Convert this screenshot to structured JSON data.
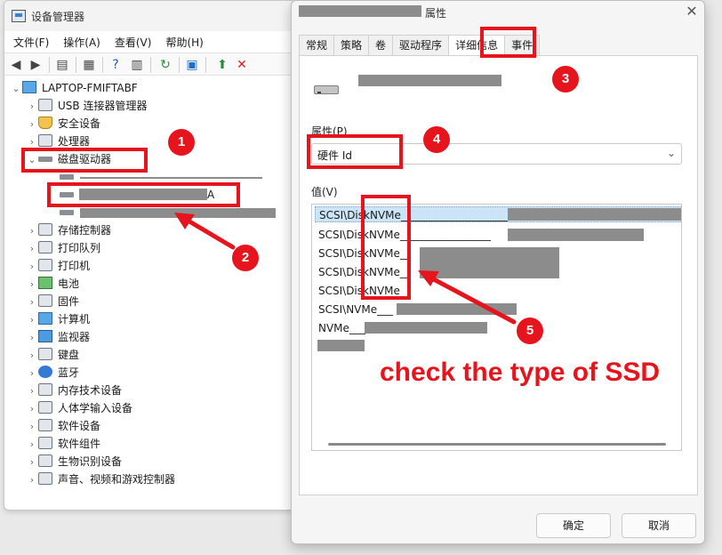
{
  "device_manager": {
    "title": "设备管理器",
    "menu": [
      "文件(F)",
      "操作(A)",
      "查看(V)",
      "帮助(H)"
    ],
    "root": "LAPTOP-FMIFTABF",
    "tree": [
      {
        "label": "USB 连接器管理器",
        "expanded": false
      },
      {
        "label": "安全设备",
        "expanded": false
      },
      {
        "label": "处理器",
        "expanded": false
      },
      {
        "label": "磁盘驱动器",
        "expanded": true
      },
      {
        "label": "存储控制器",
        "expanded": false
      },
      {
        "label": "打印队列",
        "expanded": false
      },
      {
        "label": "打印机",
        "expanded": false
      },
      {
        "label": "电池",
        "expanded": false
      },
      {
        "label": "固件",
        "expanded": false
      },
      {
        "label": "计算机",
        "expanded": false
      },
      {
        "label": "监视器",
        "expanded": false
      },
      {
        "label": "键盘",
        "expanded": false
      },
      {
        "label": "蓝牙",
        "expanded": false
      },
      {
        "label": "内存技术设备",
        "expanded": false
      },
      {
        "label": "人体学输入设备",
        "expanded": false
      },
      {
        "label": "软件设备",
        "expanded": false
      },
      {
        "label": "软件组件",
        "expanded": false
      },
      {
        "label": "生物识别设备",
        "expanded": false
      },
      {
        "label": "声音、视频和游戏控制器",
        "expanded": false
      }
    ],
    "disk_child_suffix": "A"
  },
  "properties": {
    "title": "属性",
    "tabs": [
      "常规",
      "策略",
      "卷",
      "驱动程序",
      "详细信息",
      "事件"
    ],
    "active_tab": "详细信息",
    "property_label": "属性(P)",
    "property_value": "硬件 Id",
    "value_label": "值(V)",
    "values": [
      "SCSI\\DiskNVMe____________________",
      "SCSI\\DiskNVMe_________________",
      "SCSI\\DiskNVMe__",
      "SCSI\\DiskNVMe__",
      "SCSI\\DiskNVMe__",
      "SCSI\\NVMe___",
      "NVMe___"
    ],
    "ok_label": "确定",
    "cancel_label": "取消"
  },
  "annotations": {
    "badges": [
      "1",
      "2",
      "3",
      "4",
      "5"
    ],
    "caption": "check the type of SSD",
    "color": "#e6141c"
  }
}
